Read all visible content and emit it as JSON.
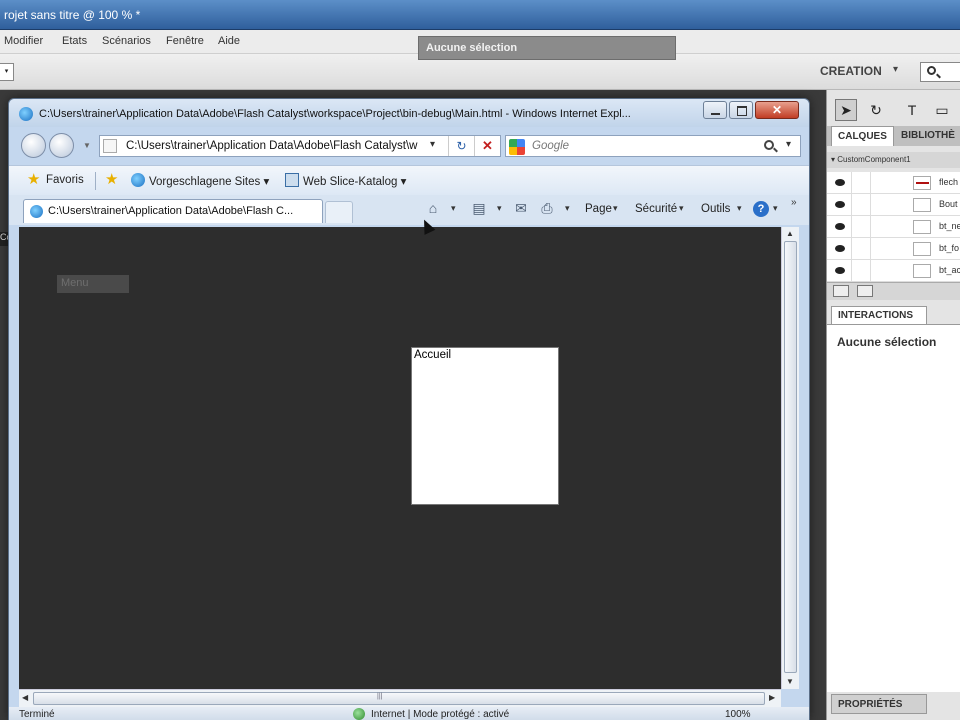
{
  "app": {
    "title": "rojet sans titre @ 100 % *",
    "menu": [
      "Modifier",
      "Etats",
      "Scénarios",
      "Fenêtre",
      "Aide"
    ],
    "left_control": "▾",
    "workspace_label": "CREATION",
    "workspace_caret": "▾",
    "tooltip": "Aucune sélection",
    "left_strip": "Co"
  },
  "panel": {
    "tools": [
      "➤",
      "↻",
      "T",
      "▭"
    ],
    "tabs": [
      "CALQUES",
      "BIBLIOTHÈ"
    ],
    "layer_group": "▾  CustomComponent1",
    "layers": [
      "flech",
      "Bout",
      "bt_ne",
      "bt_fo",
      "bt_ac"
    ],
    "interactions_tab": "INTERACTIONS",
    "interactions_empty": "Aucune sélection",
    "properties_tab": "PROPRIÉTÉS"
  },
  "ie": {
    "title": "C:\\Users\\trainer\\Application Data\\Adobe\\Flash Catalyst\\workspace\\Project\\bin-debug\\Main.html - Windows Internet Expl...",
    "address": "C:\\Users\\trainer\\Application Data\\Adobe\\Flash Catalyst\\w",
    "address_caret": "▾",
    "refresh_icon": "↻",
    "stop_icon": "✕",
    "search_placeholder": "Google",
    "search_caret": "▾",
    "favorites": {
      "favoris": "Favoris",
      "suggested": "Vorgeschlagene Sites ▾",
      "slices": "Web Slice-Katalog ▾"
    },
    "tab_label": "C:\\Users\\trainer\\Application Data\\Adobe\\Flash C...",
    "commands": {
      "page": "Page",
      "securite": "Sécurité",
      "outils": "Outils",
      "caret": "▾",
      "help": "?",
      "more": "»"
    },
    "content": {
      "menu_label": "Menu",
      "box_label": "Accueil"
    },
    "status": {
      "left": "Terminé",
      "zone": "Internet | Mode protégé : activé",
      "zoom": "100%"
    }
  }
}
